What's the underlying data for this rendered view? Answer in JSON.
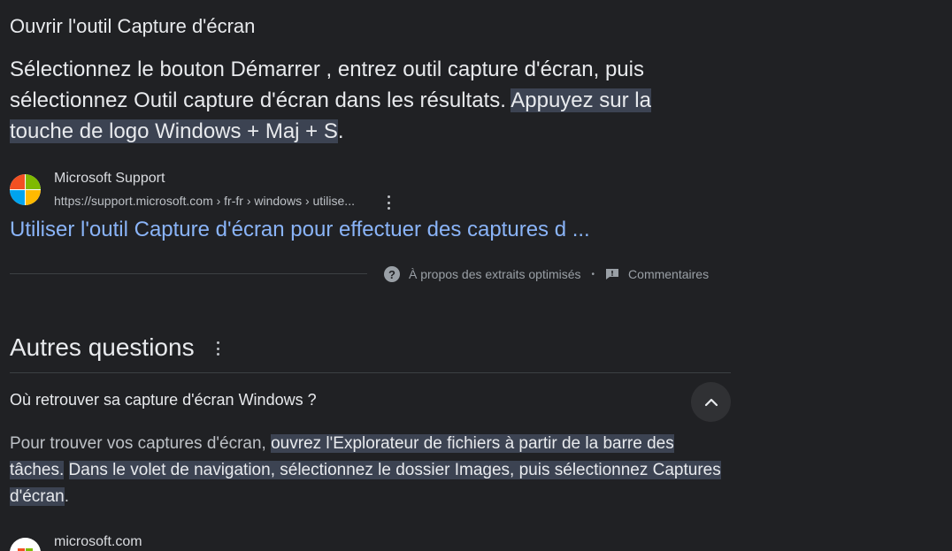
{
  "featured_snippet": {
    "title": "Ouvrir l'outil Capture d'écran",
    "text_plain": "Sélectionnez le bouton Démarrer , entrez outil capture d'écran, puis sélectionnez Outil capture d'écran dans les résultats. ",
    "text_highlight_1": "Appuyez sur la",
    "text_highlight_2": "touche de logo Windows + Maj + S",
    "text_end": ".",
    "source": {
      "name": "Microsoft Support",
      "url": "https://support.microsoft.com › fr-fr › windows › utilise...",
      "logo_icon": "microsoft-logo-icon"
    },
    "link_text": "Utiliser l'outil Capture d'écran pour effectuer des captures d ...",
    "about_label": "À propos des extraits optimisés",
    "separator": "•",
    "feedback_label": "Commentaires"
  },
  "people_also_ask": {
    "title": "Autres questions",
    "question": "Où retrouver sa capture d'écran Windows ?",
    "answer_plain_1": "Pour trouver vos captures d'écran, ",
    "answer_highlight_1": "ouvrez l'Explorateur de fichiers à partir de la barre des tâches.",
    "answer_space": " ",
    "answer_highlight_2": "Dans le volet de navigation, sélectionnez le dossier Images, puis sélectionnez Captures d'écran",
    "answer_end": ".",
    "source_name": "microsoft.com"
  },
  "colors": {
    "background": "#202124",
    "text": "#e8eaed",
    "link": "#8ab4f8",
    "highlight": "#3c4352",
    "muted": "#9aa0a6"
  }
}
